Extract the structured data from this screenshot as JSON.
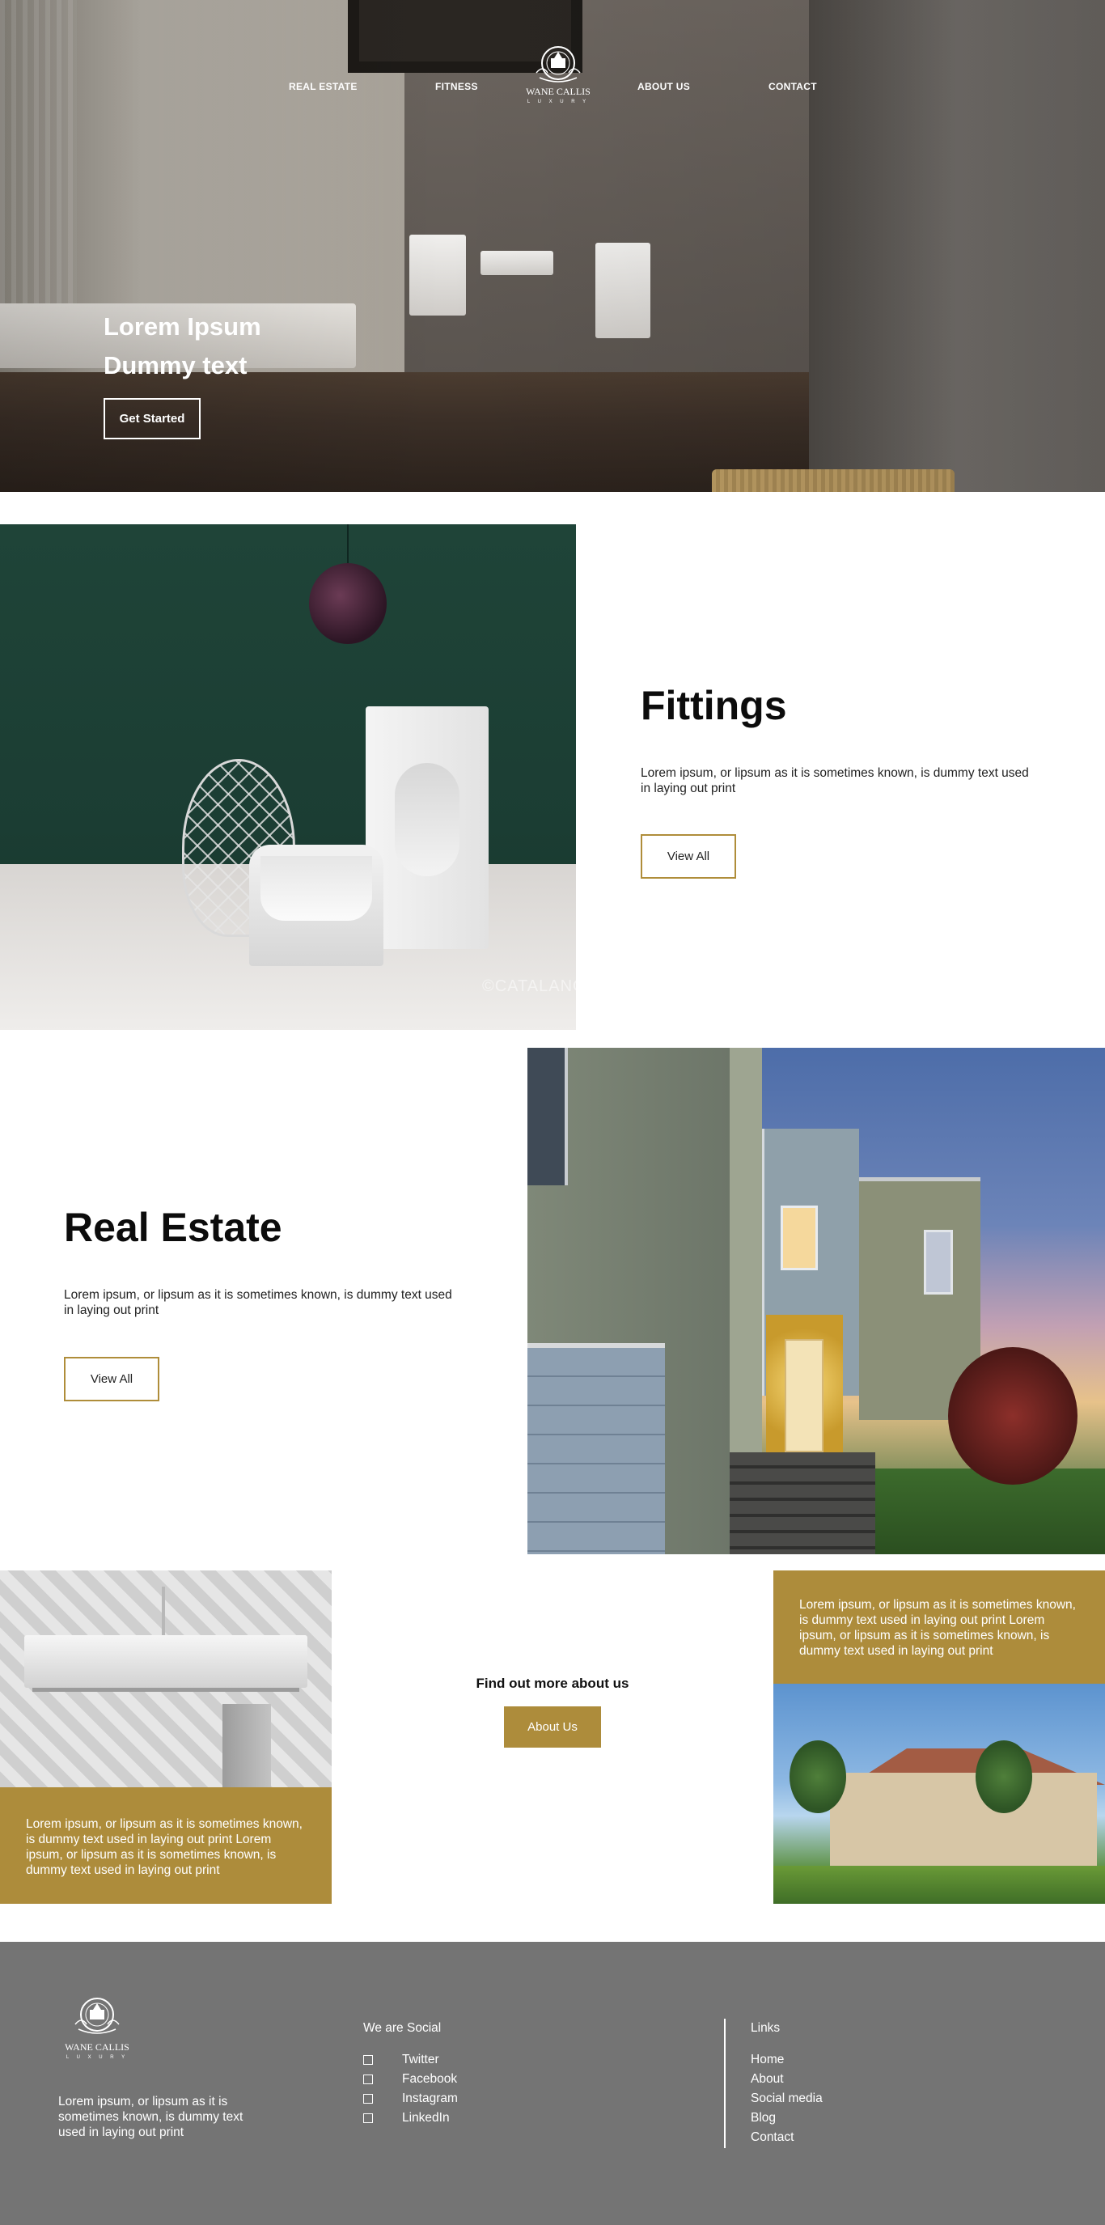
{
  "brand": {
    "name": "WANE CALLIS",
    "tagline": "L U X U R Y"
  },
  "nav": {
    "items": [
      {
        "label": "REAL ESTATE"
      },
      {
        "label": "FITNESS"
      },
      {
        "label": "ABOUT US"
      },
      {
        "label": "CONTACT"
      }
    ]
  },
  "hero": {
    "title_line1": "Lorem Ipsum",
    "title_line2": "Dummy text",
    "button": "Get Started"
  },
  "fittings": {
    "title": "Fittings",
    "text": "Lorem ipsum, or lipsum as it is sometimes known, is dummy text used in laying out print",
    "button": "View All",
    "image_watermark": "©CATALANO"
  },
  "real_estate": {
    "title": "Real Estate",
    "text": "Lorem ipsum, or lipsum as it is sometimes known, is dummy text used in laying out print",
    "button": "View All"
  },
  "promo": {
    "left_text": "Lorem ipsum, or lipsum as it is sometimes known, is dummy text used in laying out print Lorem ipsum, or lipsum as it is sometimes known, is dummy text used in laying out print",
    "cta_title": "Find out more about us",
    "cta_button": "About Us",
    "right_text": "Lorem ipsum, or lipsum as it is sometimes known, is dummy text used in laying out print Lorem ipsum, or lipsum as it is sometimes known, is dummy text used in laying out print"
  },
  "footer": {
    "about": "Lorem ipsum, or lipsum as it is sometimes known, is dummy text used in laying out print",
    "social_title": "We are Social",
    "social": [
      {
        "label": "Twitter"
      },
      {
        "label": "Facebook"
      },
      {
        "label": "Instagram"
      },
      {
        "label": "LinkedIn"
      }
    ],
    "links_title": "Links",
    "links": [
      {
        "label": "Home"
      },
      {
        "label": "About"
      },
      {
        "label": "Social media"
      },
      {
        "label": "Blog"
      },
      {
        "label": "Contact"
      }
    ]
  },
  "colors": {
    "accent_gold": "#ad8c3b",
    "footer_bg": "#747474",
    "text_dark": "#0c0c0c"
  }
}
